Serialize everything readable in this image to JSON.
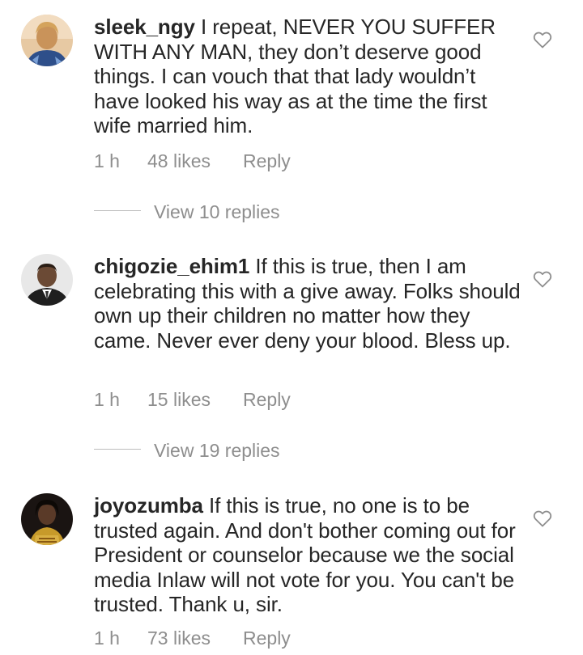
{
  "comments": [
    {
      "username": "sleek_ngy",
      "text": "I repeat,  NEVER YOU SUFFER WITH ANY MAN, they don’t deserve good things. I can vouch that that lady wouldn’t have looked his way as at the time the first wife married him.",
      "time": "1 h",
      "likes": "48 likes",
      "reply_label": "Reply",
      "view_replies": "View 10 replies",
      "avatar_icon": "profile-photo"
    },
    {
      "username": "chigozie_ehim1",
      "text": "If this is true, then I am celebrating this with a give away. Folks should own up their children no matter how they came. Never ever deny your blood. Bless up.",
      "time": "1 h",
      "likes": "15 likes",
      "reply_label": "Reply",
      "view_replies": "View 19 replies",
      "avatar_icon": "profile-photo"
    },
    {
      "username": "joyozumba",
      "text": "If this is true, no one is to be trusted again. And don't bother coming out for President or counselor because we the social media Inlaw will not vote for you. You can't be trusted. Thank u, sir.",
      "time": "1 h",
      "likes": "73 likes",
      "reply_label": "Reply",
      "avatar_icon": "profile-photo"
    }
  ],
  "icons": {
    "like": "heart-outline-icon"
  },
  "colors": {
    "text": "#262626",
    "secondary": "#8e8e8e",
    "background": "#ffffff"
  }
}
